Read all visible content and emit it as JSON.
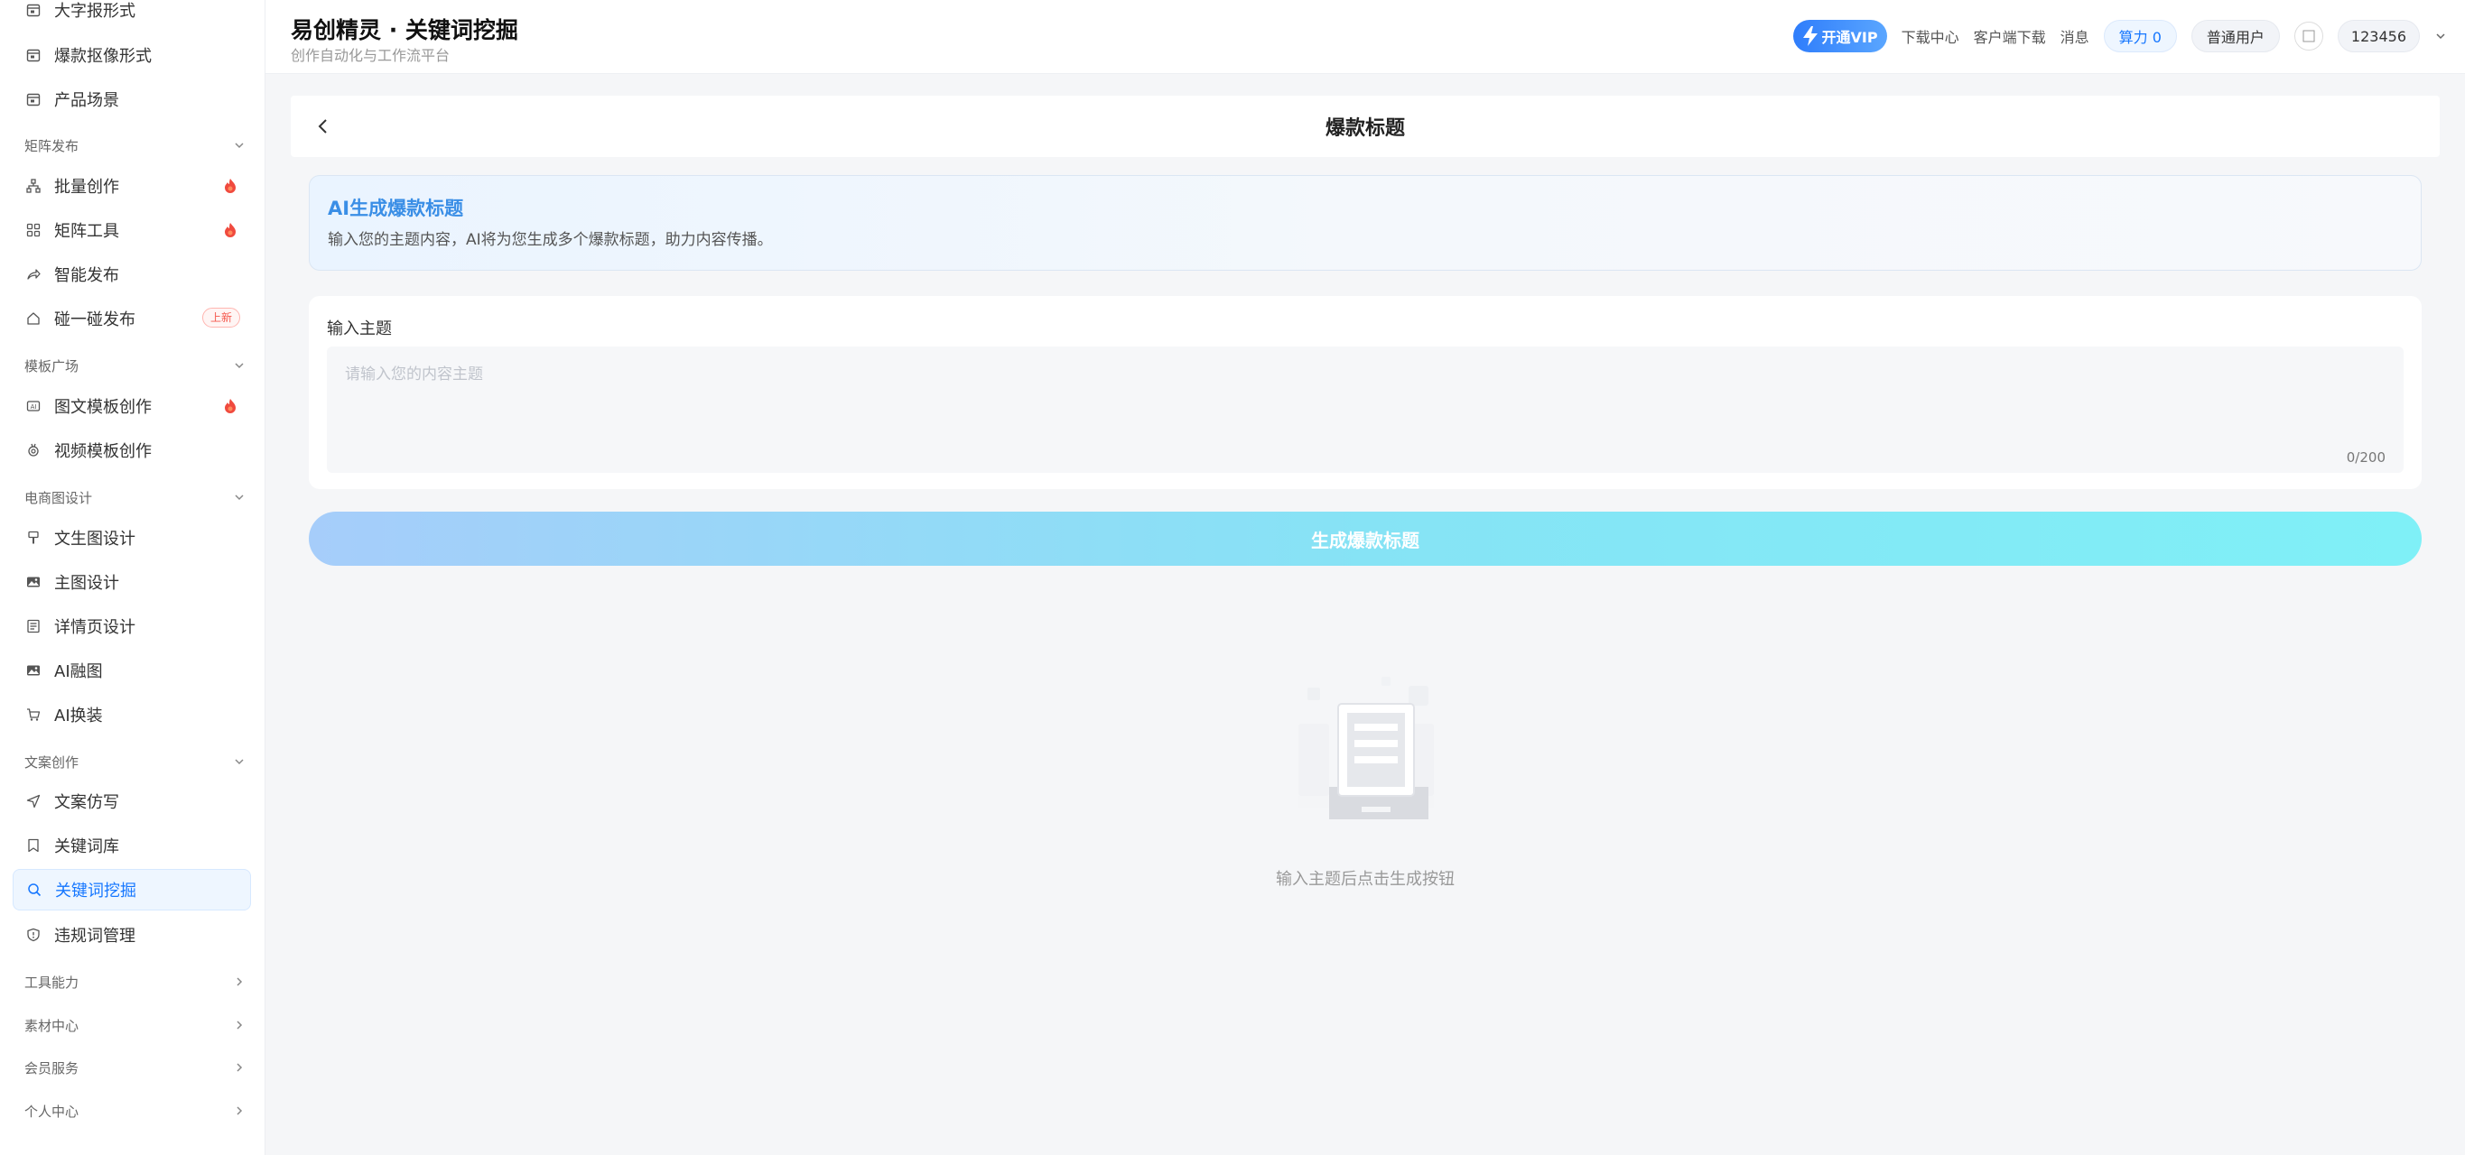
{
  "app": {
    "title": "易创精灵 · 关键词挖掘",
    "subtitle": "创作自动化与工作流平台"
  },
  "header": {
    "vip": "开通VIP",
    "download_center": "下载中心",
    "client_download": "客户端下载",
    "messages": "消息",
    "power": "算力 0",
    "user_type": "普通用户",
    "username": "123456"
  },
  "sidebar": {
    "top_items": [
      {
        "label": "大字报形式",
        "icon": "calendar-icon"
      },
      {
        "label": "爆款抠像形式",
        "icon": "calendar-icon"
      },
      {
        "label": "产品场景",
        "icon": "calendar-icon"
      }
    ],
    "groups": [
      {
        "label": "矩阵发布"
      },
      {
        "label": "模板广场"
      },
      {
        "label": "电商图设计"
      },
      {
        "label": "文案创作"
      },
      {
        "label": "工具能力"
      },
      {
        "label": "素材中心"
      },
      {
        "label": "会员服务"
      },
      {
        "label": "个人中心"
      }
    ],
    "matrix_items": [
      {
        "label": "批量创作",
        "icon": "sitemap-icon"
      },
      {
        "label": "矩阵工具",
        "icon": "grid-icon"
      },
      {
        "label": "智能发布",
        "icon": "share-icon"
      },
      {
        "label": "碰一碰发布",
        "icon": "home-icon",
        "badge": "上新"
      }
    ],
    "template_items": [
      {
        "label": "图文模板创作",
        "icon": "card-icon"
      },
      {
        "label": "视频模板创作",
        "icon": "medal-icon"
      }
    ],
    "ecommerce_items": [
      {
        "label": "文生图设计",
        "icon": "brush-icon"
      },
      {
        "label": "主图设计",
        "icon": "image-icon"
      },
      {
        "label": "详情页设计",
        "icon": "list-icon"
      },
      {
        "label": "AI融图",
        "icon": "image-icon"
      },
      {
        "label": "AI换装",
        "icon": "cart-icon"
      }
    ],
    "copy_items": [
      {
        "label": "文案仿写",
        "icon": "send-icon"
      },
      {
        "label": "关键词库",
        "icon": "bookmark-icon"
      },
      {
        "label": "关键词挖掘",
        "icon": "search-icon"
      },
      {
        "label": "违规词管理",
        "icon": "shield-icon"
      }
    ]
  },
  "page": {
    "title": "爆款标题",
    "intro_title": "AI生成爆款标题",
    "intro_desc": "输入您的主题内容，AI将为您生成多个爆款标题，助力内容传播。",
    "input_label": "输入主题",
    "input_placeholder": "请输入您的内容主题",
    "input_value": "",
    "counter": "0/200",
    "generate_button": "生成爆款标题",
    "empty_text": "输入主题后点击生成按钮"
  },
  "colors": {
    "accent": "#1677ff",
    "intro_title": "#3a8ee6",
    "button_gradient_start": "#a6cdfa",
    "button_gradient_end": "#7ff0f7",
    "new_badge": "#f5584d"
  }
}
